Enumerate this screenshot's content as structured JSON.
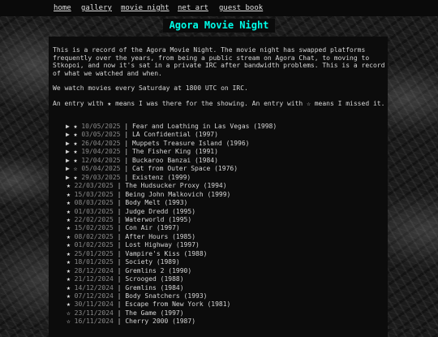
{
  "nav": {
    "items": [
      "home",
      "gallery",
      "movie night",
      "net_art",
      "guest book"
    ]
  },
  "page_title": "Agora Movie Night",
  "intro": {
    "paragraph1": "This is a record of the Agora Movie Night. The movie night has swapped platforms frequently over the years, from being a public stream on Agora Chat, to moving to Stkopoi, and now it's sat in a private IRC after bandwidth problems. This is a record of what we watched and when.",
    "paragraph2": "We watch movies every Saturday at 1800 UTC on IRC.",
    "paragraph3": "An entry with ★ means I was there for the showing. An entry with ☆ means I missed it."
  },
  "colors": {
    "title": "#00ffea",
    "background": "#1b1b1b",
    "panel": "#0c0c0c",
    "date": "#8a8a8a"
  },
  "movies": [
    {
      "expandable": true,
      "attended": "★",
      "date": "10/05/2025",
      "sep": "|",
      "title": "Fear and Loathing in Las Vegas (1998)"
    },
    {
      "expandable": true,
      "attended": "★",
      "date": "03/05/2025",
      "sep": "|",
      "title": "LA Confidential (1997)"
    },
    {
      "expandable": true,
      "attended": "★",
      "date": "26/04/2025",
      "sep": "|",
      "title": "Muppets Treasure Island (1996)"
    },
    {
      "expandable": true,
      "attended": "★",
      "date": "19/04/2025",
      "sep": "|",
      "title": "The Fisher King (1991)"
    },
    {
      "expandable": true,
      "attended": "★",
      "date": "12/04/2025",
      "sep": "|",
      "title": "Buckaroo Banzai (1984)"
    },
    {
      "expandable": true,
      "attended": "☆",
      "date": "05/04/2025",
      "sep": "|",
      "title": "Cat from Outer Space (1976)"
    },
    {
      "expandable": true,
      "attended": "★",
      "date": "29/03/2025",
      "sep": "|",
      "title": "Existenz (1999)"
    },
    {
      "expandable": false,
      "attended": "★",
      "date": "22/03/2025",
      "sep": "|",
      "title": "The Hudsucker Proxy (1994)"
    },
    {
      "expandable": false,
      "attended": "★",
      "date": "15/03/2025",
      "sep": "|",
      "title": "Being John Malkovich (1999)"
    },
    {
      "expandable": false,
      "attended": "★",
      "date": "08/03/2025",
      "sep": "|",
      "title": "Body Melt (1993)"
    },
    {
      "expandable": false,
      "attended": "★",
      "date": "01/03/2025",
      "sep": "|",
      "title": "Judge Dredd (1995)"
    },
    {
      "expandable": false,
      "attended": "★",
      "date": "22/02/2025",
      "sep": "|",
      "title": "Waterworld (1995)"
    },
    {
      "expandable": false,
      "attended": "★",
      "date": "15/02/2025",
      "sep": "|",
      "title": "Con Air (1997)"
    },
    {
      "expandable": false,
      "attended": "★",
      "date": "08/02/2025",
      "sep": "|",
      "title": "After Hours (1985)"
    },
    {
      "expandable": false,
      "attended": "★",
      "date": "01/02/2025",
      "sep": "|",
      "title": "Lost Highway (1997)"
    },
    {
      "expandable": false,
      "attended": "★",
      "date": "25/01/2025",
      "sep": "|",
      "title": "Vampire's Kiss (1988)"
    },
    {
      "expandable": false,
      "attended": "★",
      "date": "18/01/2025",
      "sep": "|",
      "title": "Society (1989)"
    },
    {
      "expandable": false,
      "attended": "★",
      "date": "28/12/2024",
      "sep": "|",
      "title": "Gremlins 2 (1990)"
    },
    {
      "expandable": false,
      "attended": "★",
      "date": "21/12/2024",
      "sep": "|",
      "title": "Scrooged (1988)"
    },
    {
      "expandable": false,
      "attended": "★",
      "date": "14/12/2024",
      "sep": "|",
      "title": "Gremlins (1984)"
    },
    {
      "expandable": false,
      "attended": "★",
      "date": "07/12/2024",
      "sep": "|",
      "title": "Body Snatchers (1993)"
    },
    {
      "expandable": false,
      "attended": "★",
      "date": "30/11/2024",
      "sep": "|",
      "title": "Escape from New York (1981)"
    },
    {
      "expandable": false,
      "attended": "☆",
      "date": "23/11/2024",
      "sep": "|",
      "title": "The Game (1997)"
    },
    {
      "expandable": false,
      "attended": "☆",
      "date": "16/11/2024",
      "sep": "|",
      "title": "Cherry 2000 (1987)"
    }
  ],
  "expand_glyph": "▶"
}
